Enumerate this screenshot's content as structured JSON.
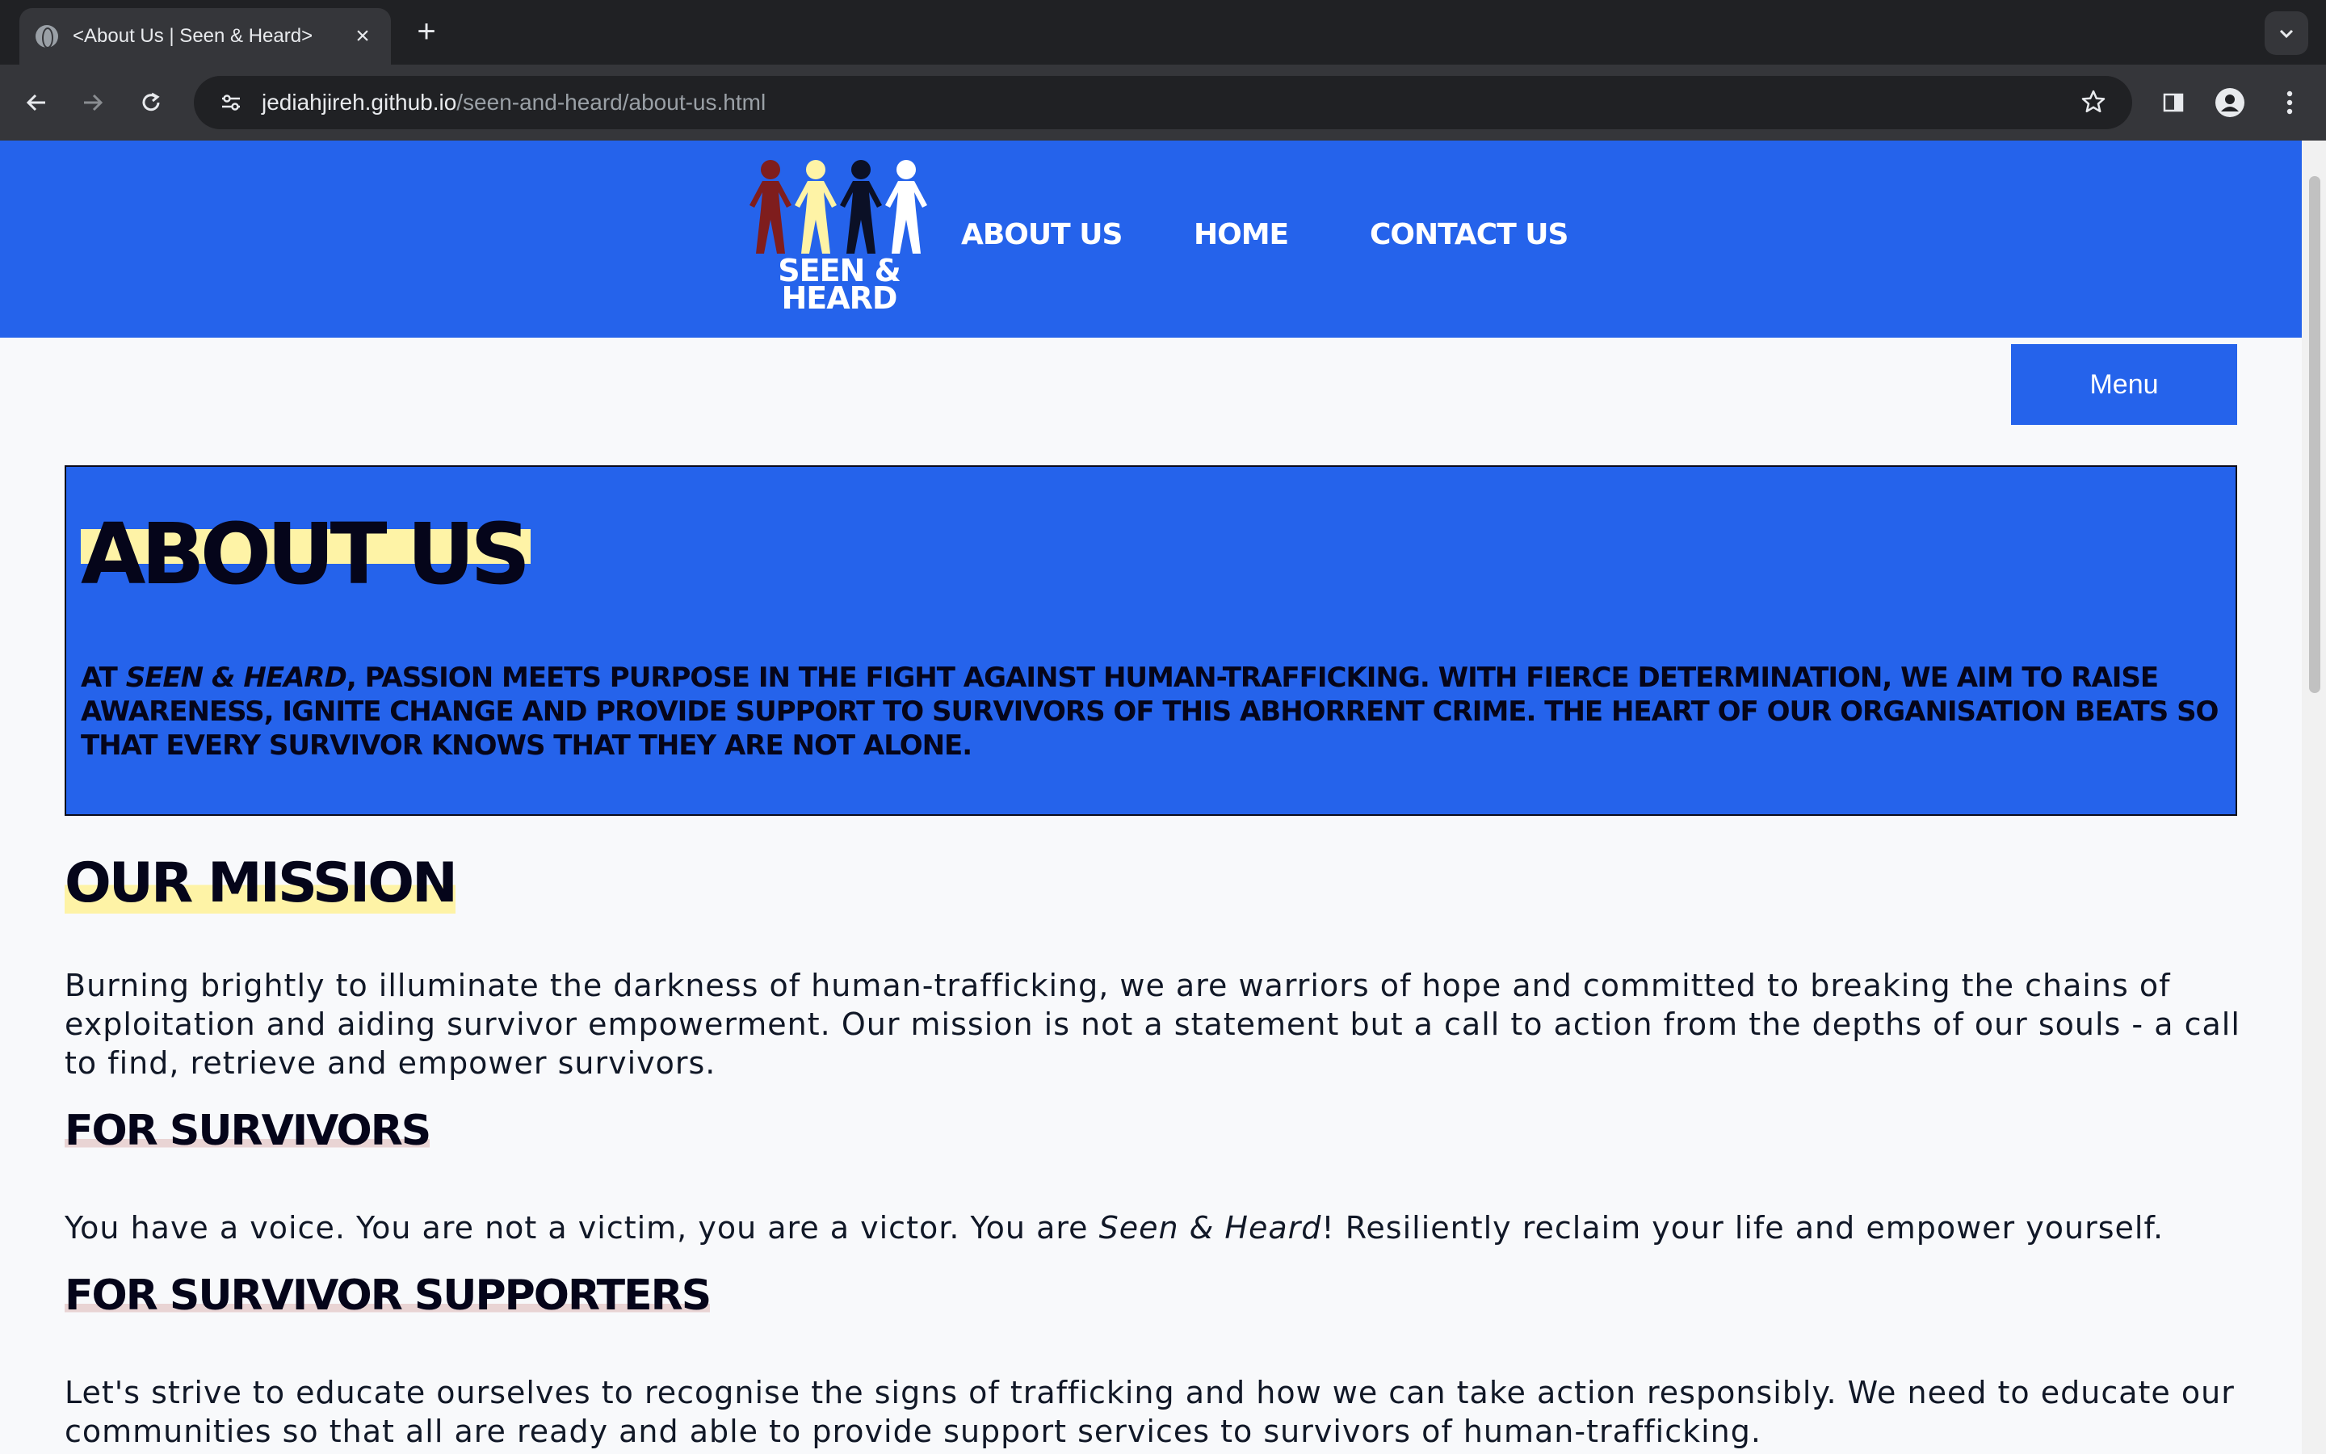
{
  "browser": {
    "tab_title": "<About Us | Seen & Heard>",
    "url_host": "jediahjireh.github.io",
    "url_path": "/seen-and-heard/about-us.html"
  },
  "header": {
    "logo_text_line1": "SEEN &",
    "logo_text_line2": "HEARD",
    "nav": [
      "ABOUT US",
      "HOME",
      "CONTACT US"
    ],
    "colors": {
      "header_bg": "#2563eb",
      "figure_1": "#7f1d1d",
      "figure_2": "#fef3a6",
      "figure_3": "#0b1026",
      "figure_4": "#ffffff"
    }
  },
  "menu_button": "Menu",
  "intro": {
    "title": "ABOUT US",
    "text_prefix": "At ",
    "text_em": "Seen & Heard",
    "text_suffix": ", passion meets purpose in the fight against human-trafficking. With fierce determination, we aim to raise awareness, ignite change and provide support to survivors of this abhorrent crime. The heart of our organisation beats so that every survivor knows that they are not alone."
  },
  "mission": {
    "title": "OUR MISSION",
    "text": "Burning brightly to illuminate the darkness of human-trafficking, we are warriors of hope and committed to breaking the chains of exploitation and aiding survivor empowerment. Our mission is not a statement but a call to action from the depths of our souls - a call to find, retrieve and empower survivors."
  },
  "survivors": {
    "title": "FOR SURVIVORS",
    "text_prefix": "You have a voice. You are not a victim, you are a victor. You are ",
    "text_em": "Seen & Heard",
    "text_suffix": "! Resiliently reclaim your life and empower yourself."
  },
  "supporters": {
    "title": "FOR SURVIVOR SUPPORTERS",
    "text": "Let's strive to educate ourselves to recognise the signs of trafficking and how we can take action responsibly. We need to educate our communities so that all are ready and able to provide support services to survivors of human-trafficking."
  }
}
